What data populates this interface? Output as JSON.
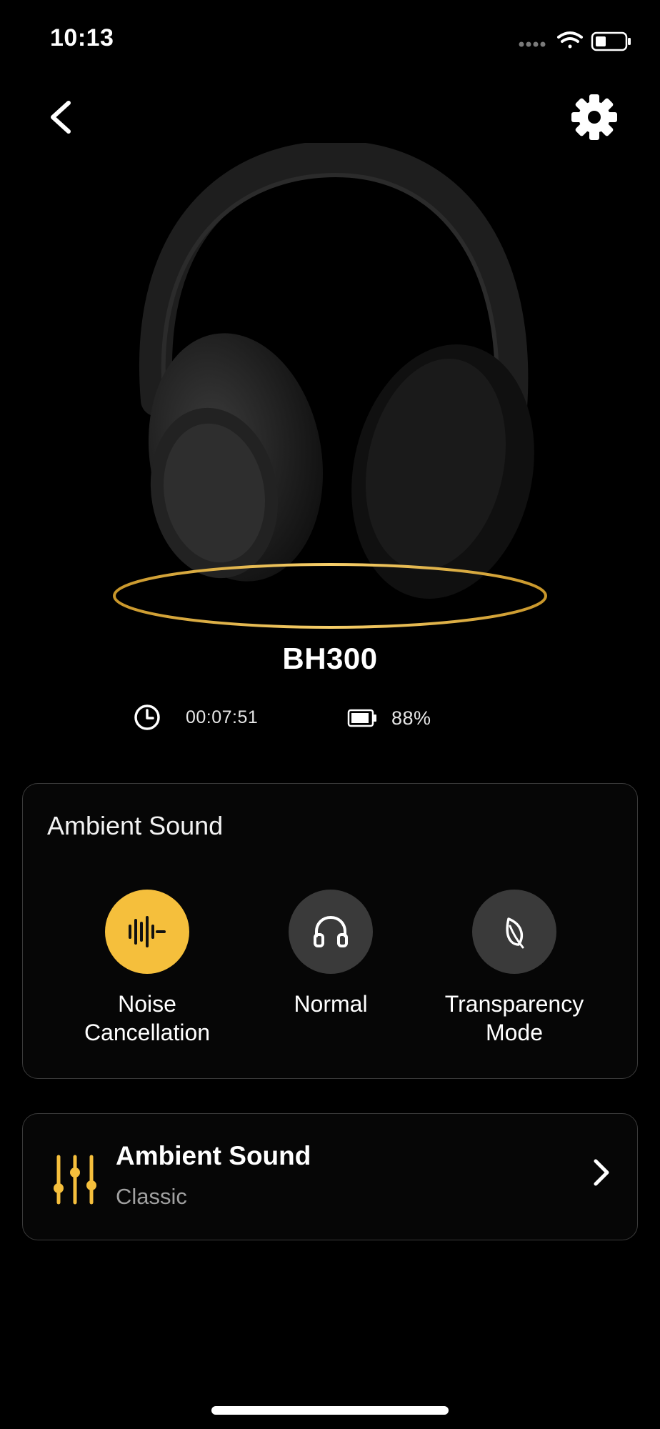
{
  "status_bar": {
    "time": "10:13"
  },
  "device": {
    "name": "BH300",
    "play_time": "00:07:51",
    "battery": "88%"
  },
  "ambient_card": {
    "title": "Ambient Sound",
    "modes": [
      {
        "label_line1": "Noise",
        "label_line2": "Cancellation",
        "active": true,
        "icon": "waveform-icon"
      },
      {
        "label_line1": "Normal",
        "label_line2": "",
        "active": false,
        "icon": "headphones-icon"
      },
      {
        "label_line1": "Transparency",
        "label_line2": "Mode",
        "active": false,
        "icon": "leaf-icon"
      }
    ]
  },
  "eq_card": {
    "title": "Ambient Sound",
    "subtitle": "Classic",
    "icon": "equalizer-icon"
  },
  "colors": {
    "accent": "#F5BF3C",
    "background": "#000000",
    "card_border": "#3A3A3A",
    "inactive_circle": "#3A3A3A"
  }
}
